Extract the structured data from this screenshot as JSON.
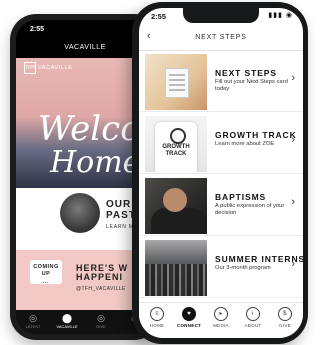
{
  "back_phone": {
    "status_time": "2:55",
    "title": "VACAVILLE",
    "logo_badge": "TFH",
    "logo_text": "VACAVILLE",
    "hero_line1": "Welco",
    "hero_line2": "Home",
    "pastor_line1": "OUR",
    "pastor_line2": "PASTO",
    "pastor_link": "LEARN M",
    "coming_line1": "COMING",
    "coming_line2": "UP",
    "coming_line3": "...",
    "heres_line1": "HERE'S W",
    "heres_line2": "HAPPENI",
    "handle": "@TFH_VACAVILLE",
    "tabs": [
      {
        "label": "LATEST",
        "icon": "circle-icon"
      },
      {
        "label": "VACAVILLE",
        "icon": "location-pin-icon"
      },
      {
        "label": "GIVE",
        "icon": "circle-icon"
      },
      {
        "label": "",
        "icon": "circle-icon"
      }
    ]
  },
  "front_phone": {
    "status_time": "2:55",
    "status_icons": "▮▮▮ ◉",
    "header_title": "NEXT STEPS",
    "back_icon": "‹",
    "items": [
      {
        "title": "NEXT STEPS",
        "subtitle": "Fill out your Next Steps card today"
      },
      {
        "title": "GROWTH TRACK",
        "subtitle": "Learn more about ZOE",
        "thumb_text": "GROWTH TRACK"
      },
      {
        "title": "BAPTISMS",
        "subtitle": "A public expression of your decision"
      },
      {
        "title": "SUMMER INTERNS",
        "subtitle": "Our 3-month program"
      }
    ],
    "tabs": [
      {
        "label": "HOME",
        "glyph": "≡"
      },
      {
        "label": "CONNECT",
        "glyph": "♥"
      },
      {
        "label": "MEDIA",
        "glyph": "▸"
      },
      {
        "label": "ABOUT",
        "glyph": "i"
      },
      {
        "label": "GIVE",
        "glyph": "$"
      }
    ]
  }
}
